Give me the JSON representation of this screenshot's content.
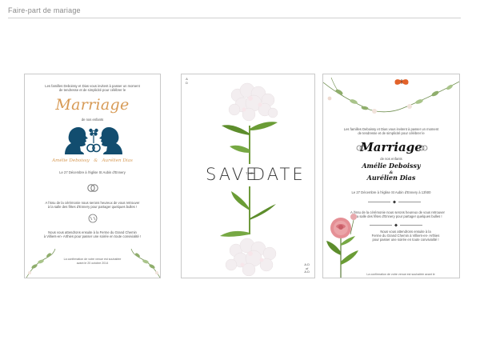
{
  "page": {
    "title": "Faire-part de mariage"
  },
  "cards": [
    {
      "intro": "Les familles Deboissy et Dias vous invitent à passer un moment",
      "intro2": "de tendresse et de simplicité pour célébrer le",
      "headline": "Marriage",
      "children_intro": "de nos enfants",
      "name_left": "Amélie Deboissy",
      "name_amp": "&",
      "name_right": "Aurélien Dias",
      "date_line": "Le 27 Décembre à l'église St Aubin d'Ennery",
      "after_ceremony": "A l'issu de la cérémonie nous serons heureux de vous retrouver",
      "after_ceremony2": "à la salle des fêtes d'Ennery pour partager quelques bulles !",
      "dinner": "Nous vous attendrons ensuite à la Ferme du Grand Chemin",
      "dinner2": "à Villiers-en- Arthies pour passer une soirée en toute convivialité !",
      "confirm": "La confirmation de votre venue est souhaitée",
      "confirm2": "avant le 20 octobre 2014",
      "silhouette_color": "#124d6f",
      "accent": "#d79a55"
    },
    {
      "save": "SAVE",
      "the": "THE",
      "date": "DATE",
      "monogram_top": [
        "A",
        "D"
      ],
      "monogram_bottom_1": "A.D",
      "monogram_bottom_2": "of",
      "monogram_bottom_3": "A.D"
    },
    {
      "intro": "Les familles Deboissy et Dias vous invitent à passer un moment",
      "intro2": "de tendresse et de simplicité pour célébrer le",
      "headline": "Marriage",
      "children_intro": "de nos enfants",
      "name_left": "Amélie Deboissy",
      "name_amp": "&",
      "name_right": "Aurélien Dias",
      "date_line": "Le 27 Décembre à l'église St Aubin d'Ennery à 13h00",
      "after_ceremony": "A l'issu de la cérémonie nous serons heureux de vous retrouver",
      "after_ceremony2": "à la salle des fêtes d'Ennery pour partager quelques bulles !",
      "dinner": "Nous vous attendrons ensuite à la",
      "dinner2": "Ferme du Grand Chemin à Villiers-en- Arthies",
      "dinner3": "pour passer une soirée en toute convivialité !",
      "confirm": "La confirmation de votre venue est souhaitée avant le",
      "butterfly_color": "#e2622a",
      "rose_color": "#e58f95"
    }
  ]
}
